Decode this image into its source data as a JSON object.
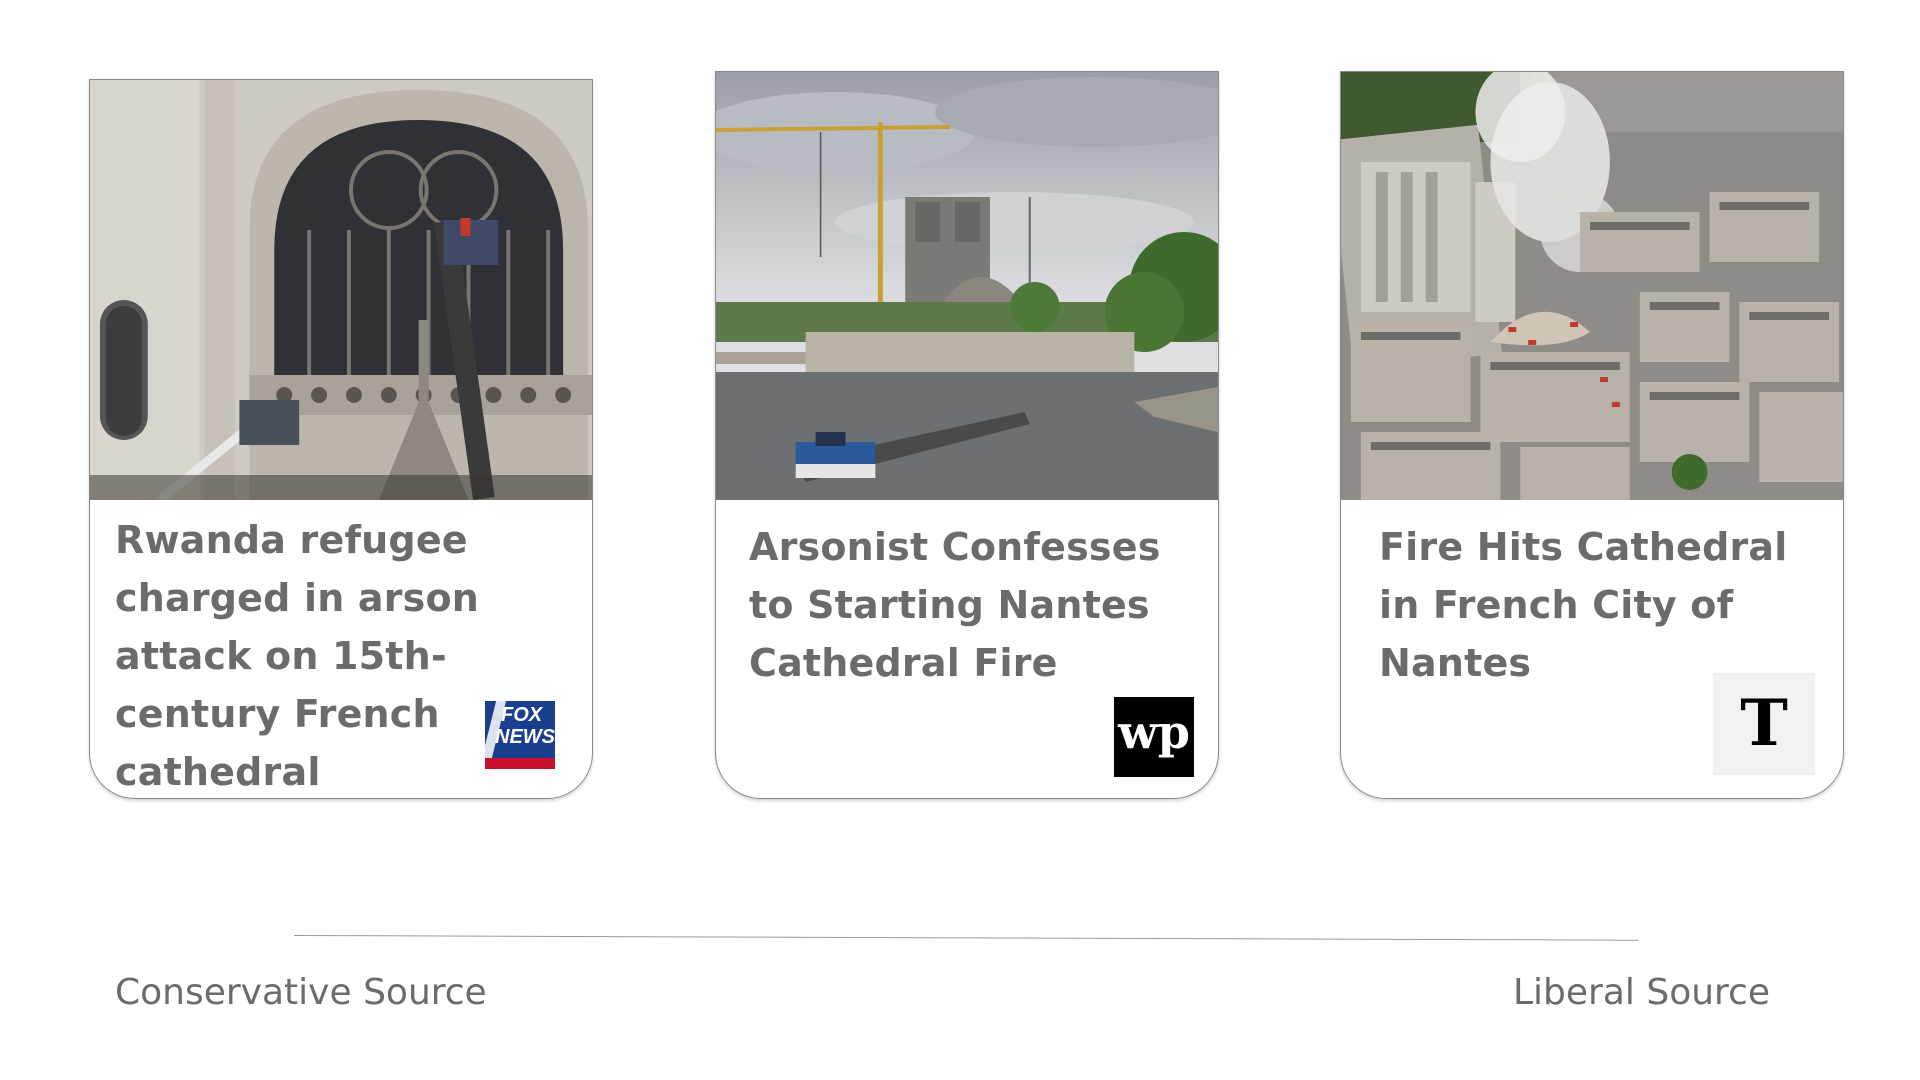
{
  "cards": [
    {
      "headline": "Rwanda refugee charged in arson attack on 15th-century French cathedral",
      "source_logo": "fox-news-logo",
      "logo_text_line1": "FOX",
      "logo_text_line2": "NEWS",
      "photo": "cathedral-facade-firefighters-photo"
    },
    {
      "headline": "Arsonist Confesses to Starting Nantes Cathedral Fire",
      "source_logo": "washington-post-logo",
      "logo_text": "wp",
      "photo": "notre-dame-river-crane-photo"
    },
    {
      "headline": "Fire Hits Cathedral in French City of Nantes",
      "source_logo": "new-york-times-logo",
      "logo_text": "T",
      "photo": "aerial-cathedral-smoke-photo"
    }
  ],
  "scale": {
    "left_label": "Conservative Source",
    "right_label": "Liberal Source"
  },
  "colors": {
    "headline_text": "#6b6b6b",
    "fox_blue": "#1a3f8f",
    "fox_red": "#c8102e",
    "wp_black": "#000000",
    "nyt_bg": "#f2f2f2"
  }
}
